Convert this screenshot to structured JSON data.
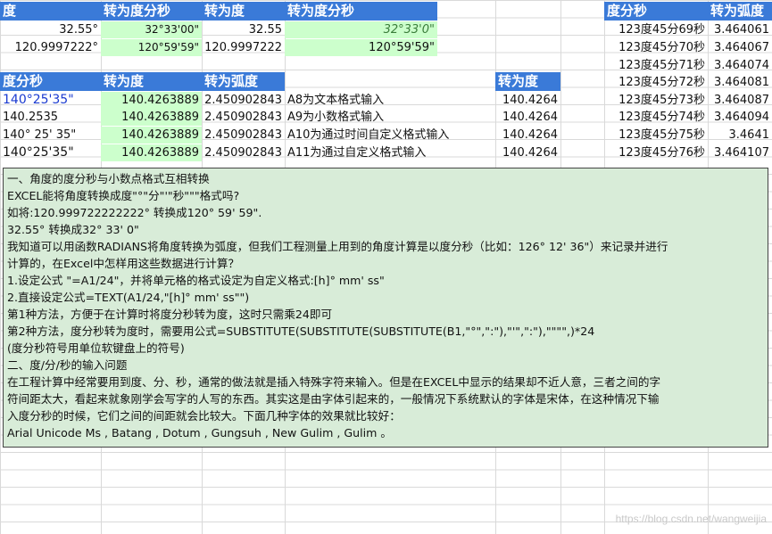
{
  "top_left": {
    "headers": [
      "度",
      "转为度分秒",
      "转为度",
      "转为度分秒"
    ],
    "rows": [
      [
        "32.55°",
        "32°33'00\"",
        "32.55",
        "32°33'0\""
      ],
      [
        "120.9997222°",
        "120°59'59\"",
        "120.9997222",
        "120°59'59\""
      ]
    ]
  },
  "right_table": {
    "headers": [
      "度分秒",
      "转为弧度"
    ],
    "rows": [
      [
        "123度45分69秒",
        "3.464061"
      ],
      [
        "123度45分70秒",
        "3.464067"
      ],
      [
        "123度45分71秒",
        "3.464074"
      ],
      [
        "123度45分72秒",
        "3.464081"
      ],
      [
        "123度45分73秒",
        "3.464087"
      ],
      [
        "123度45分74秒",
        "3.464094"
      ],
      [
        "123度45分75秒",
        "3.4641"
      ],
      [
        "123度45分76秒",
        "3.464107"
      ]
    ]
  },
  "mid_table": {
    "headers": [
      "度分秒",
      "转为度",
      "转为弧度"
    ],
    "extra_header": "转为度",
    "rows": [
      [
        "140°25'35\"",
        "140.4263889",
        "2.450902843",
        "A8为文本格式输入",
        "140.4264"
      ],
      [
        "140.2535",
        "140.4263889",
        "2.450902843",
        "A9为小数格式输入",
        "140.4264"
      ],
      [
        "140° 25' 35\"",
        "140.4263889",
        "2.450902843",
        "A10为通过时间自定义格式输入",
        "140.4264"
      ],
      [
        "140°25'35\"",
        "140.4263889",
        "2.450902843",
        "A11为通过自定义格式输入",
        "140.4264"
      ]
    ]
  },
  "textbox": {
    "lines": [
      "一、角度的度分秒与小数点格式互相转换",
      "EXCEL能将角度转换成度\"°\"分\"'\"秒\"\"\"格式吗?",
      "如将:120.999722222222° 转换成120° 59' 59\".",
      "     32.55° 转换成32° 33' 0\"",
      "我知道可以用函数RADIANS将角度转换为弧度，但我们工程测量上用到的角度计算是以度分秒（比如：126° 12' 36\"）来记录并进行",
      "计算的，在Excel中怎样用这些数据进行计算？",
      "1.设定公式 \"=A1/24\"，并将单元格的格式设定为自定义格式:[h]° mm' ss\"",
      "2.直接设定公式=TEXT(A1/24,\"[h]° mm' ss\"\")",
      "第1种方法，方便于在计算时将度分秒转为度，这时只需乘24即可",
      "第2种方法，度分秒转为度时，需要用公式=SUBSTITUTE(SUBSTITUTE(SUBSTITUTE(B1,\"°\",\":\"),\"'\",\":\"),\"\"\"\",)*24",
      "(度分秒符号用单位软键盘上的符号)",
      "二、度/分/秒的输入问题",
      "在工程计算中经常要用到度、分、秒，通常的做法就是插入特殊字符来输入。但是在EXCEL中显示的结果却不近人意，三者之间的字",
      "符间距太大，看起来就象刚学会写字的人写的东西。其实这是由字体引起来的，一般情况下系统默认的字体是宋体，在这种情况下输",
      "入度分秒的时候，它们之间的间距就会比较大。下面几种字体的效果就比较好：",
      "Arial Unicode Ms , Batang , Dotum , Gungsuh , New Gulim , Gulim 。"
    ]
  },
  "watermark": "https://blog.csdn.net/wangweijia",
  "colors": {
    "header_blue": "#3a7ad8",
    "green_cell": "#ccffcc",
    "textbox_bg": "#d8ecd8"
  }
}
